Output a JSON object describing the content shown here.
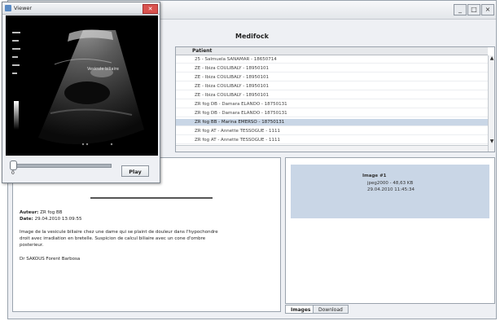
{
  "main_window": {
    "title": "",
    "header_title": "Medifock",
    "window_buttons": [
      "_",
      "□",
      "×"
    ]
  },
  "patient_list": {
    "column_header": "Patient",
    "rows": [
      "25 - Salmuela SANAMAR - 18650714",
      "ZE - Ibiza COULIBALY - 18950101",
      "ZE - Ibiza COULIBALY - 18950101",
      "ZE - Ibiza COULIBALY - 18950101",
      "ZE - Ibiza COULIBALY - 18950101",
      "ZR fog DB - Damara ELANDO - 18750131",
      "ZR fog DB - Damara ELANDO - 18750131",
      "ZR fog BB - Marina EMERSO - 18750131",
      "ZR fog AT - Annette TESSOGUE - 1111",
      "ZR fog AT - Annette TESSOGUE - 1111"
    ],
    "selected_index": 7
  },
  "report": {
    "author_label": "Auteur:",
    "author_value": "ZR fog BB",
    "date_label": "Date:",
    "date_value": "29.04.2010 13:09:55",
    "body_lines": [
      "Image de la vesicule biliaire chez une dame qui se plaint de douleur dans l'hypochondre",
      "droit avec irradiation en bretelle. Suspicion de calcul biliaire avec un cone d'ombre",
      "posterieur."
    ],
    "signature": "Dr SAKOUS Forent Barbosa"
  },
  "images_panel": {
    "card_title": "Image #1",
    "card_line1": "jpeg2000 - 48,63 KB",
    "card_line2": "29.04.2010 11:45:34",
    "tabs": [
      "Images",
      "Download"
    ],
    "active_tab": 0
  },
  "viewer": {
    "title": "Viewer",
    "close_glyph": "✕",
    "annotation": "Vesicule biliaire",
    "frame_value": "0",
    "play_label": "Play",
    "slider_position": 0.0
  }
}
